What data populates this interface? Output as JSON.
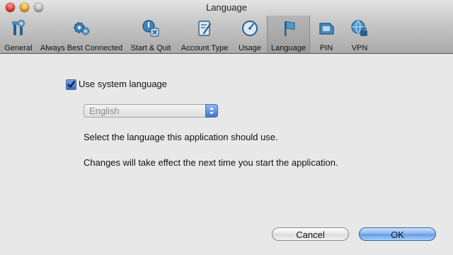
{
  "window": {
    "title": "Language"
  },
  "toolbar": {
    "items": [
      {
        "label": "General",
        "icon": "tools-icon",
        "selected": false
      },
      {
        "label": "Always Best Connected",
        "icon": "gears-icon",
        "selected": false
      },
      {
        "label": "Start & Quit",
        "icon": "power-quit-icon",
        "selected": false
      },
      {
        "label": "Account Type",
        "icon": "account-document-icon",
        "selected": false
      },
      {
        "label": "Usage",
        "icon": "gauge-icon",
        "selected": false
      },
      {
        "label": "Language",
        "icon": "flag-icon",
        "selected": true
      },
      {
        "label": "PIN",
        "icon": "sim-card-icon",
        "selected": false
      },
      {
        "label": "VPN",
        "icon": "vpn-globe-lock-icon",
        "selected": false
      }
    ]
  },
  "language_pane": {
    "use_system_language": {
      "label": "Use system language",
      "checked": true
    },
    "language_popup": {
      "value": "English",
      "enabled": false
    },
    "description_1": "Select the language this application should use.",
    "description_2": "Changes will take effect the next time you start the application."
  },
  "buttons": {
    "cancel_label": "Cancel",
    "ok_label": "OK"
  },
  "colors": {
    "accent": "#3d73d4",
    "window_background": "#e8e8e8",
    "toolbar_selected": "#a8a8a8"
  }
}
